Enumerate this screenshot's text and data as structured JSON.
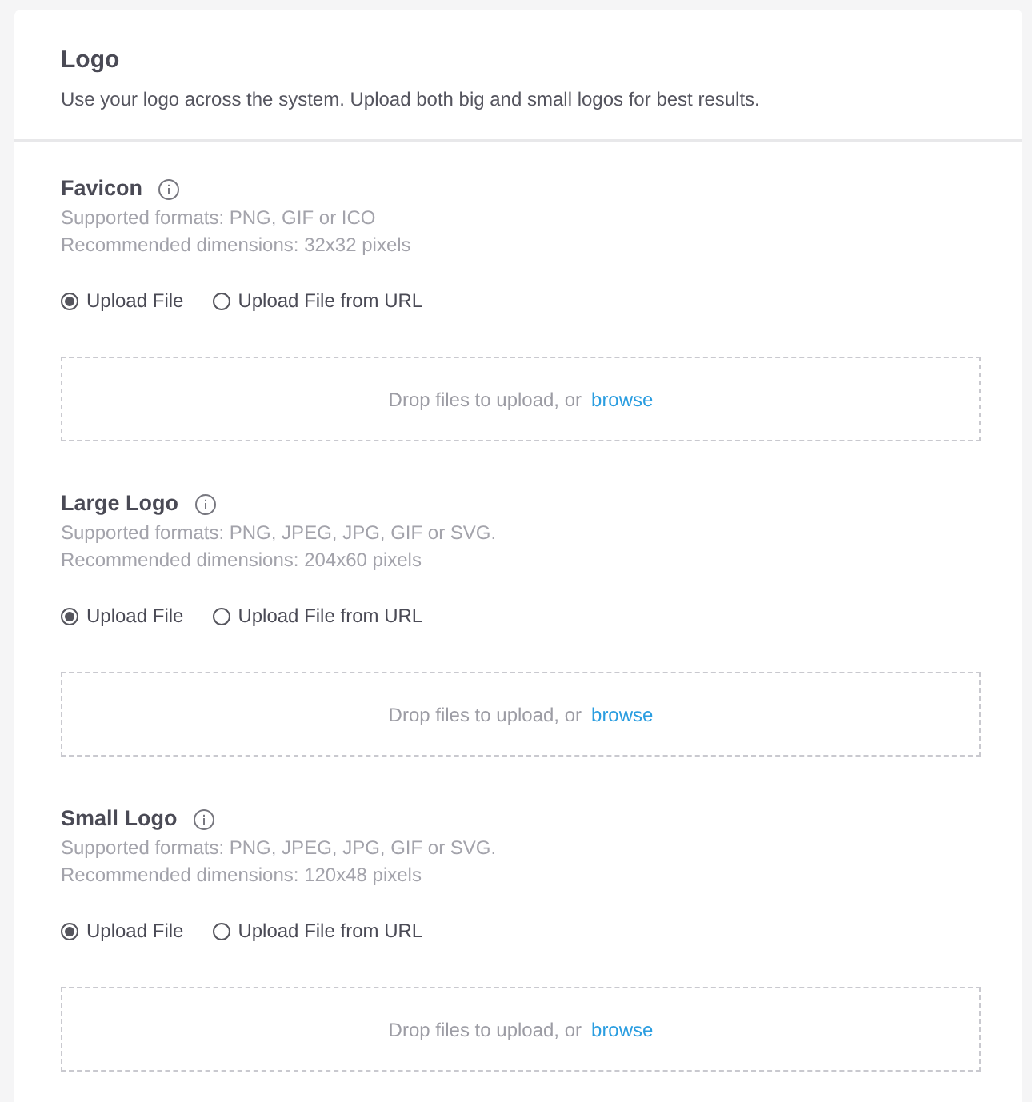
{
  "header": {
    "title": "Logo",
    "description": "Use your logo across the system. Upload both big and small logos for best results."
  },
  "sections": [
    {
      "title": "Favicon",
      "formats": "Supported formats: PNG, GIF or ICO",
      "dimensions": "Recommended dimensions: 32x32 pixels",
      "options": [
        {
          "label": "Upload File",
          "selected": true
        },
        {
          "label": "Upload File from URL",
          "selected": false
        }
      ],
      "dropzone": {
        "text": "Drop files to upload, or",
        "link": "browse"
      }
    },
    {
      "title": "Large Logo",
      "formats": "Supported formats: PNG, JPEG, JPG, GIF or SVG.",
      "dimensions": "Recommended dimensions: 204x60 pixels",
      "options": [
        {
          "label": "Upload File",
          "selected": true
        },
        {
          "label": "Upload File from URL",
          "selected": false
        }
      ],
      "dropzone": {
        "text": "Drop files to upload, or",
        "link": "browse"
      }
    },
    {
      "title": "Small Logo",
      "formats": "Supported formats: PNG, JPEG, JPG, GIF or SVG.",
      "dimensions": "Recommended dimensions: 120x48 pixels",
      "options": [
        {
          "label": "Upload File",
          "selected": true
        },
        {
          "label": "Upload File from URL",
          "selected": false
        }
      ],
      "dropzone": {
        "text": "Drop files to upload, or",
        "link": "browse"
      }
    }
  ]
}
